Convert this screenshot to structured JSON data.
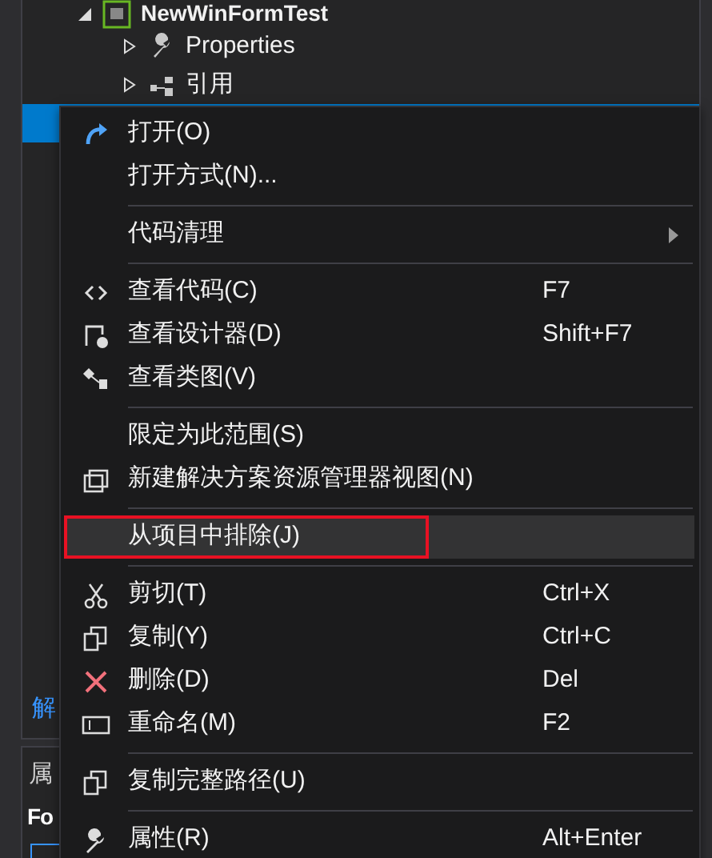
{
  "solution_explorer": {
    "tree": [
      {
        "label": "NewWinFormTest",
        "expanded": true,
        "selected": false,
        "children": [
          {
            "label": "Properties",
            "expanded": false,
            "selected": false
          },
          {
            "label": "引用",
            "expanded": false,
            "selected": false
          },
          {
            "selected": true
          }
        ]
      }
    ],
    "tab_label": "解"
  },
  "properties_panel": {
    "title": "属",
    "object": "Fo"
  },
  "context_menu": [
    {
      "kind": "item",
      "label": "打开(O)",
      "selected": false
    },
    {
      "kind": "item",
      "label": "打开方式(N)...",
      "selected": false
    },
    {
      "kind": "separator"
    },
    {
      "kind": "item",
      "label": "代码清理",
      "submenu": true,
      "selected": false
    },
    {
      "kind": "separator"
    },
    {
      "kind": "item",
      "label": "查看代码(C)",
      "shortcut": "F7",
      "selected": false
    },
    {
      "kind": "item",
      "label": "查看设计器(D)",
      "shortcut": "Shift+F7",
      "selected": false
    },
    {
      "kind": "item",
      "label": "查看类图(V)",
      "selected": false
    },
    {
      "kind": "separator"
    },
    {
      "kind": "item",
      "label": "限定为此范围(S)",
      "selected": false
    },
    {
      "kind": "item",
      "label": "新建解决方案资源管理器视图(N)",
      "selected": false
    },
    {
      "kind": "separator"
    },
    {
      "kind": "item",
      "label": "从项目中排除(J)",
      "selected": true,
      "annotated": true
    },
    {
      "kind": "separator"
    },
    {
      "kind": "item",
      "label": "剪切(T)",
      "shortcut": "Ctrl+X",
      "selected": false
    },
    {
      "kind": "item",
      "label": "复制(Y)",
      "shortcut": "Ctrl+C",
      "selected": false
    },
    {
      "kind": "item",
      "label": "删除(D)",
      "shortcut": "Del",
      "selected": false
    },
    {
      "kind": "item",
      "label": "重命名(M)",
      "shortcut": "F2",
      "selected": false
    },
    {
      "kind": "separator"
    },
    {
      "kind": "item",
      "label": "复制完整路径(U)",
      "selected": false
    },
    {
      "kind": "separator"
    },
    {
      "kind": "item",
      "label": "属性(R)",
      "shortcut": "Alt+Enter",
      "selected": false
    }
  ]
}
